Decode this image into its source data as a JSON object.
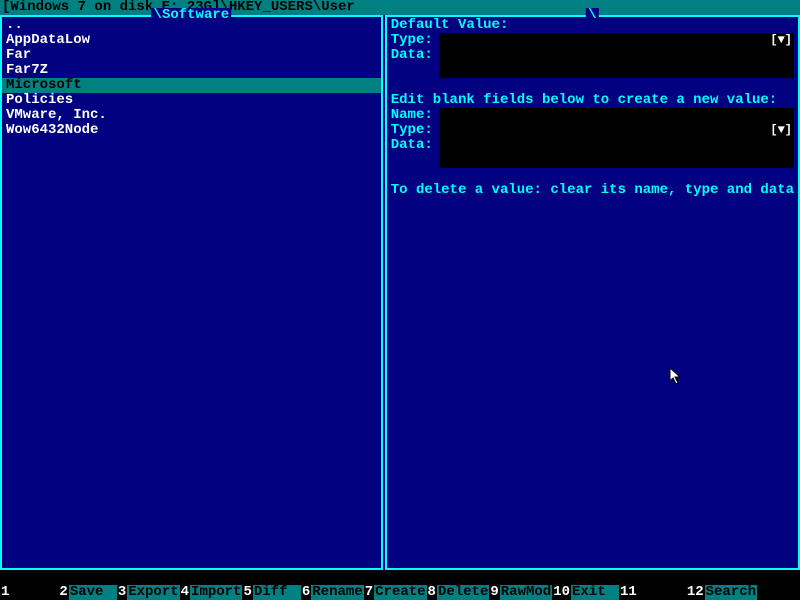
{
  "title": "[Windows 7 on disk E: 23G]\\HKEY_USERS\\User",
  "left_panel": {
    "title": "\\Software",
    "items": [
      {
        "label": "..",
        "selected": false
      },
      {
        "label": "AppDataLow",
        "selected": false
      },
      {
        "label": "Far",
        "selected": false
      },
      {
        "label": "Far7Z",
        "selected": false
      },
      {
        "label": "Microsoft",
        "selected": true
      },
      {
        "label": "Policies",
        "selected": false
      },
      {
        "label": "VMware, Inc.",
        "selected": false
      },
      {
        "label": "Wow6432Node",
        "selected": false
      }
    ]
  },
  "right_panel": {
    "title": "\\",
    "default_value_label": "Default Value:",
    "type_label": "Type:",
    "data_label": "Data:",
    "name_label": "Name:",
    "edit_hint": "Edit blank fields below to create a new value:",
    "delete_hint": "To delete a value: clear its name, type and data",
    "dropdown_glyph": "[▼]",
    "default_type_value": "",
    "default_data_value": "",
    "new_name_value": "",
    "new_type_value": "",
    "new_data_value": ""
  },
  "fnkeys": [
    {
      "num": "1",
      "label": "      "
    },
    {
      "num": "2",
      "label": "Save  "
    },
    {
      "num": "3",
      "label": "Export"
    },
    {
      "num": "4",
      "label": "Import"
    },
    {
      "num": "5",
      "label": "Diff  "
    },
    {
      "num": "6",
      "label": "Rename"
    },
    {
      "num": "7",
      "label": "Create"
    },
    {
      "num": "8",
      "label": "Delete"
    },
    {
      "num": "9",
      "label": "RawMod"
    },
    {
      "num": "10",
      "label": "Exit  "
    },
    {
      "num": "11",
      "label": "      "
    },
    {
      "num": "12",
      "label": "Search"
    }
  ]
}
